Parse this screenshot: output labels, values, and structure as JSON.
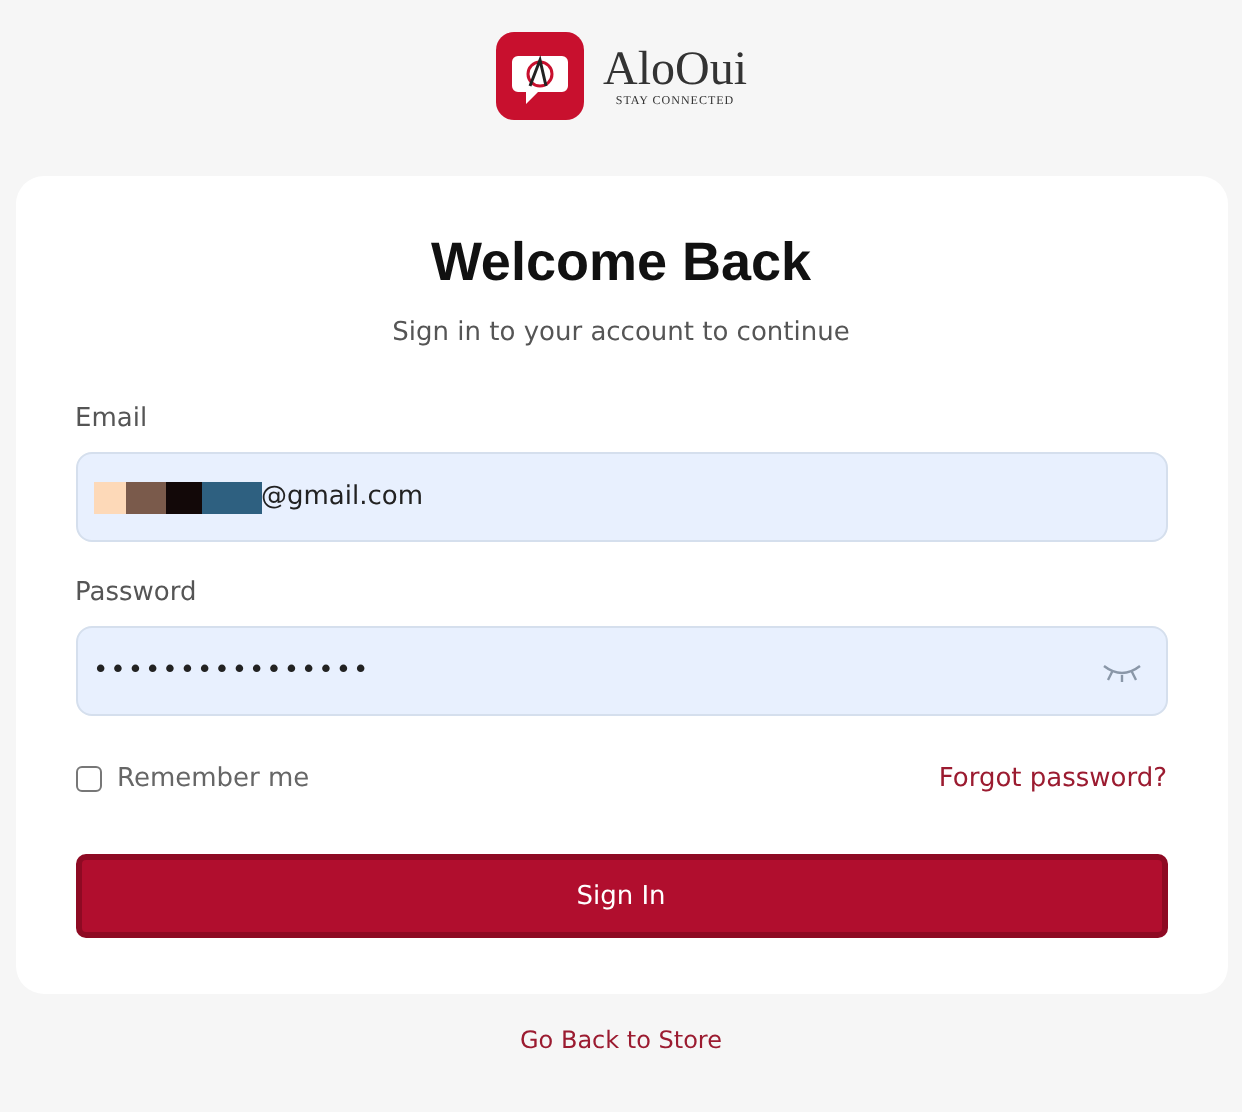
{
  "logo": {
    "wordmark": "AloOui",
    "tagline": "STAY CONNECTED"
  },
  "title": "Welcome Back",
  "subtitle": "Sign in to your account to continue",
  "email": {
    "label": "Email",
    "value": "@gmail.com",
    "redacted": true
  },
  "password": {
    "label": "Password",
    "value": "••••••••••••••••"
  },
  "remember": {
    "label": "Remember me",
    "checked": false
  },
  "forgot": "Forgot password?",
  "submit": "Sign In",
  "back_link": "Go Back to Store"
}
